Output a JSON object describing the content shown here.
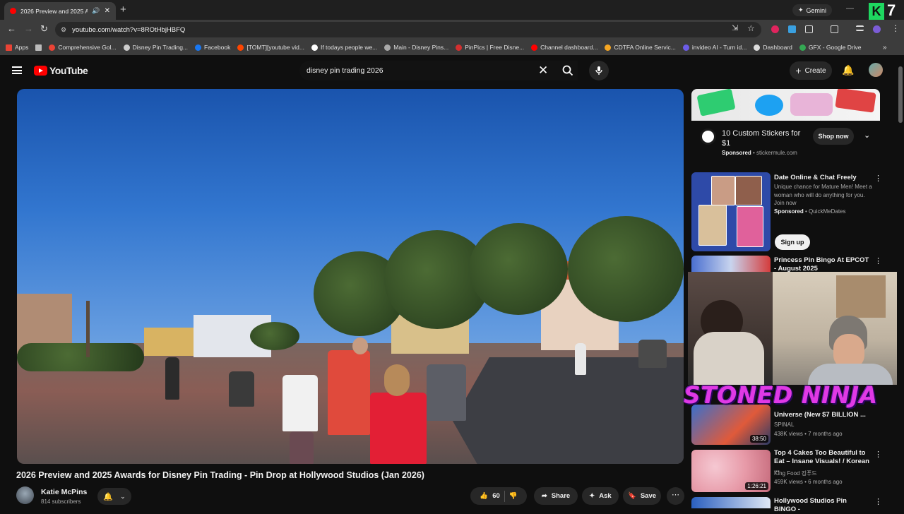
{
  "browser": {
    "tab_title": "2026 Preview and 2025 Aw",
    "url": "youtube.com/watch?v=8ROtHbjHBFQ",
    "gemini_label": "Gemini",
    "brand_badge": "7",
    "bookmarks": [
      {
        "label": "Apps",
        "color": "#e94335"
      },
      {
        "label": "Comprehensive Gol...",
        "color": "#ea4335"
      },
      {
        "label": "Disney Pin Trading...",
        "color": "#cccccc"
      },
      {
        "label": "Facebook",
        "color": "#1877f2"
      },
      {
        "label": "[TOMT][youtube vid...",
        "color": "#ff4500"
      },
      {
        "label": "If todays people we...",
        "color": "#ffffff"
      },
      {
        "label": "Main - Disney Pins...",
        "color": "#aaaaaa"
      },
      {
        "label": "PinPics | Free Disne...",
        "color": "#d32f2f"
      },
      {
        "label": "Channel dashboard...",
        "color": "#ff0000"
      },
      {
        "label": "CDTFA Online Servic...",
        "color": "#f5a623"
      },
      {
        "label": "invideo AI - Turn id...",
        "color": "#6c5ce7"
      },
      {
        "label": "Dashboard",
        "color": "#dddddd"
      },
      {
        "label": "GFX - Google Drive",
        "color": "#34a853"
      }
    ]
  },
  "youtube": {
    "logo_text": "YouTube",
    "search_query": "disney pin trading 2026",
    "create_label": "Create"
  },
  "video": {
    "title": "2026 Preview and 2025 Awards for Disney Pin Trading - Pin Drop at Hollywood Studios (Jan 2026)",
    "channel_name": "Katie McPins",
    "subscribers": "814 subscribers",
    "likes": "60",
    "share_label": "Share",
    "ask_label": "Ask",
    "save_label": "Save"
  },
  "sidebar": {
    "ad1": {
      "title": "10 Custom Stickers for $1",
      "sponsored": "Sponsored",
      "domain": "stickermule.com",
      "cta": "Shop now"
    },
    "ad2": {
      "title": "Date Online & Chat Freely",
      "desc": "Unique chance for Mature Men! Meet a woman who will do anything for you. Join now",
      "sponsored": "Sponsored",
      "advertiser": "QuickMeDates",
      "cta": "Sign up"
    },
    "items": [
      {
        "title": "Princess Pin Bingo At EPCOT - August 2025"
      },
      {
        "title": "Universe (New $7 BILLION ...",
        "channel": "SPINAL",
        "meta": "438K views • 7 months ago",
        "duration": "38:50"
      },
      {
        "title": "Top 4 Cakes Too Beautiful to Eat – Insane Visuals! / Korean ...",
        "channel": "King Food 킹푸드",
        "meta": "459K views • 6 months ago",
        "duration": "1:26:21"
      },
      {
        "title": "Hollywood Studios Pin BINGO -"
      }
    ]
  },
  "overlay": {
    "watermark": "STONED NINJA"
  }
}
